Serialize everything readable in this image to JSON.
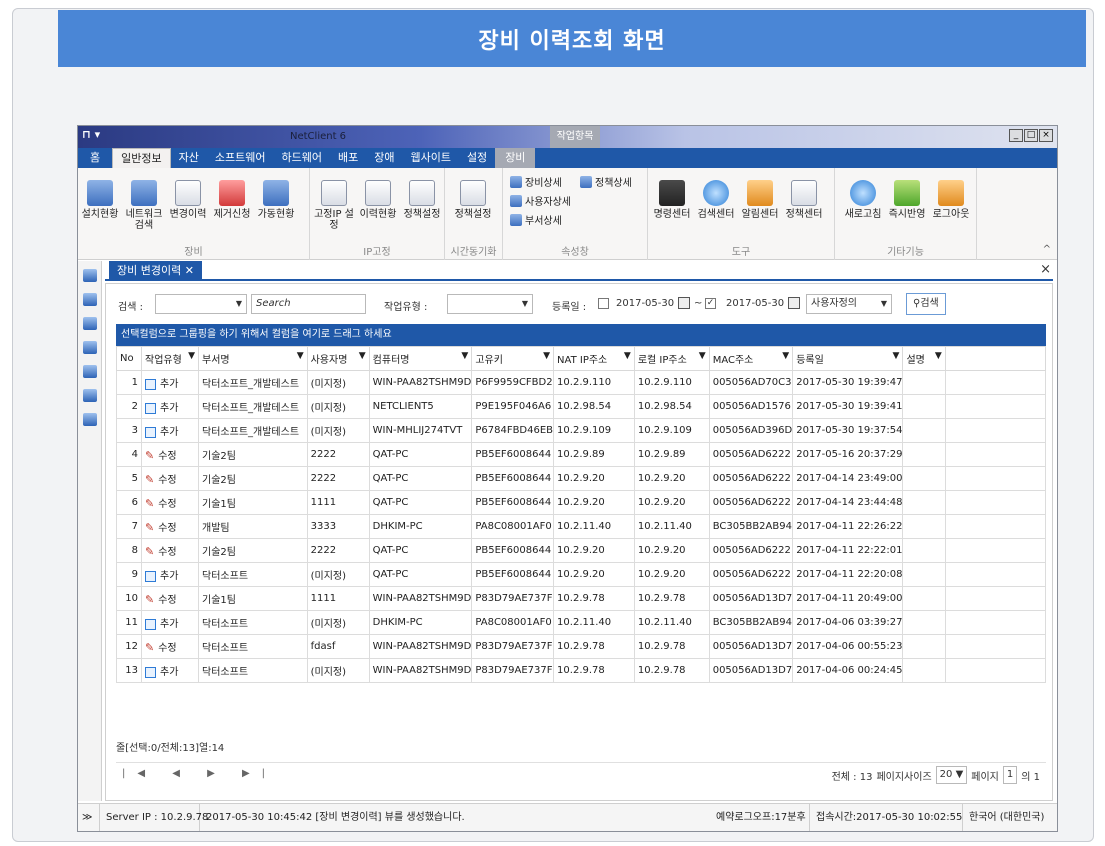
{
  "banner_title": "장비 이력조회 화면",
  "app": {
    "quick_access": "⊓ ▾",
    "title": "NetClient 6",
    "context_group": "작업항목",
    "win_buttons": [
      "_",
      "□",
      "×"
    ]
  },
  "menu": {
    "home": "홈",
    "tabs": [
      "일반정보",
      "자산",
      "소프트웨어",
      "하드웨어",
      "배포",
      "장애",
      "웹사이트",
      "설정"
    ],
    "context_tab": "장비"
  },
  "ribbon": {
    "equip_buttons": [
      "설치현황",
      "네트워크 검색",
      "변경이력",
      "제거신청",
      "가동현황"
    ],
    "equip_label": "장비",
    "ip_buttons": [
      "고정IP 설정",
      "이력현황",
      "정책설정"
    ],
    "ip_label": "IP고정",
    "time_buttons": [
      "정책설정"
    ],
    "time_label": "시간동기화",
    "prop_items": [
      "장비상세",
      "정책상세",
      "사용자상세",
      "부서상세"
    ],
    "prop_label": "속성창",
    "tool_buttons": [
      "명령센터",
      "검색센터",
      "알림센터",
      "정책센터"
    ],
    "tool_label": "도구",
    "etc_buttons": [
      "새로고침",
      "즉시반영",
      "로그아웃"
    ],
    "etc_label": "기타기능"
  },
  "doc_tab": {
    "label": "장비 변경이력 ✕",
    "close_all": "×"
  },
  "filter": {
    "search_label": "검색 :",
    "search_placeholder": "Search",
    "worktype_label": "작업유형 :",
    "date_label": "등록일 :",
    "date_from": "2017-05-30",
    "tilde": "~",
    "date_to": "2017-05-30",
    "range_option": "사용자정의",
    "search_button": "검색"
  },
  "group_hint": "선택컬럼으로 그룹핑을 하기 위해서 컬럼을 여기로 드래그 하세요",
  "columns": [
    "No",
    "작업유형",
    "부서명",
    "사용자명",
    "컴퓨터명",
    "고유키",
    "NAT IP주소",
    "로컬 IP주소",
    "MAC주소",
    "등록일",
    "설명"
  ],
  "rows": [
    [
      "1",
      "추가",
      "닥터소프트_개발테스트",
      "(미지정)",
      "WIN-PAA82TSHM9D",
      "P6F9959CFBD2",
      "10.2.9.110",
      "10.2.9.110",
      "005056AD70C3",
      "2017-05-30 19:39:47",
      ""
    ],
    [
      "2",
      "추가",
      "닥터소프트_개발테스트",
      "(미지정)",
      "NETCLIENT5",
      "P9E195F046A6",
      "10.2.98.54",
      "10.2.98.54",
      "005056AD1576",
      "2017-05-30 19:39:41",
      ""
    ],
    [
      "3",
      "추가",
      "닥터소프트_개발테스트",
      "(미지정)",
      "WIN-MHLIJ274TVT",
      "P6784FBD46EB",
      "10.2.9.109",
      "10.2.9.109",
      "005056AD396D",
      "2017-05-30 19:37:54",
      ""
    ],
    [
      "4",
      "수정",
      "기술2팀",
      "2222",
      "QAT-PC",
      "PB5EF6008644",
      "10.2.9.89",
      "10.2.9.89",
      "005056AD6222",
      "2017-05-16 20:37:29",
      ""
    ],
    [
      "5",
      "수정",
      "기술2팀",
      "2222",
      "QAT-PC",
      "PB5EF6008644",
      "10.2.9.20",
      "10.2.9.20",
      "005056AD6222",
      "2017-04-14 23:49:00",
      ""
    ],
    [
      "6",
      "수정",
      "기술1팀",
      "1111",
      "QAT-PC",
      "PB5EF6008644",
      "10.2.9.20",
      "10.2.9.20",
      "005056AD6222",
      "2017-04-14 23:44:48",
      ""
    ],
    [
      "7",
      "수정",
      "개발팀",
      "3333",
      "DHKIM-PC",
      "PA8C08001AF0",
      "10.2.11.40",
      "10.2.11.40",
      "BC305BB2AB94",
      "2017-04-11 22:26:22",
      ""
    ],
    [
      "8",
      "수정",
      "기술2팀",
      "2222",
      "QAT-PC",
      "PB5EF6008644",
      "10.2.9.20",
      "10.2.9.20",
      "005056AD6222",
      "2017-04-11 22:22:01",
      ""
    ],
    [
      "9",
      "추가",
      "닥터소프트",
      "(미지정)",
      "QAT-PC",
      "PB5EF6008644",
      "10.2.9.20",
      "10.2.9.20",
      "005056AD6222",
      "2017-04-11 22:20:08",
      ""
    ],
    [
      "10",
      "수정",
      "기술1팀",
      "1111",
      "WIN-PAA82TSHM9D",
      "P83D79AE737F",
      "10.2.9.78",
      "10.2.9.78",
      "005056AD13D7",
      "2017-04-11 20:49:00",
      ""
    ],
    [
      "11",
      "추가",
      "닥터소프트",
      "(미지정)",
      "DHKIM-PC",
      "PA8C08001AF0",
      "10.2.11.40",
      "10.2.11.40",
      "BC305BB2AB94",
      "2017-04-06 03:39:27",
      ""
    ],
    [
      "12",
      "수정",
      "닥터소프트",
      "fdasf",
      "WIN-PAA82TSHM9D",
      "P83D79AE737F",
      "10.2.9.78",
      "10.2.9.78",
      "005056AD13D7",
      "2017-04-06 00:55:23",
      ""
    ],
    [
      "13",
      "추가",
      "닥터소프트",
      "(미지정)",
      "WIN-PAA82TSHM9D",
      "P83D79AE737F",
      "10.2.9.78",
      "10.2.9.78",
      "005056AD13D7",
      "2017-04-06 00:24:45",
      ""
    ]
  ],
  "summary": "줄[선택:0/전체:13]열:14",
  "pager": {
    "nav": "|◀ ◀ ▶ ▶|",
    "total": "전체 : 13",
    "page_size_label": "페이지사이즈",
    "page_size": "20",
    "page_label": "페이지",
    "page": "1",
    "of": "의 1"
  },
  "status": {
    "server": "Server IP : 10.2.9.78",
    "message": "2017-05-30 10:45:42  [장비 변경이력] 뷰를 생성했습니다.",
    "logoff": "예약로그오프:17분후",
    "connect": "접속시간:2017-05-30 10:02:55",
    "locale": "한국어 (대한민국)"
  }
}
